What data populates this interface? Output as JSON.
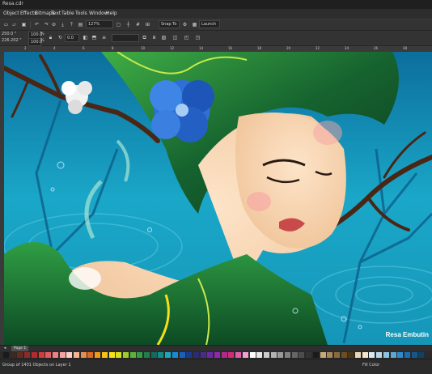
{
  "window": {
    "title": "Resa.cdr"
  },
  "menu": [
    "Object",
    "Effects",
    "Bitmaps",
    "Text",
    "Table",
    "Tools",
    "Window",
    "Help"
  ],
  "toolbar1": {
    "zoom": "127%",
    "snap_to": "Snap To",
    "launch": "Launch"
  },
  "toolbar2": {
    "x": "250.0 \"",
    "y": "226.202 \"",
    "w_percent": "100.0",
    "h_percent": "100.0",
    "pct": "%",
    "angle": "0.0"
  },
  "ruler": {
    "ticks": [
      "2",
      "4",
      "6",
      "8",
      "10",
      "12",
      "14",
      "16",
      "18",
      "20",
      "22",
      "24",
      "26",
      "28"
    ]
  },
  "canvas": {
    "signature": "Resa Embutin"
  },
  "pages": {
    "label": "Page 1"
  },
  "palette": {
    "colors": [
      "#1a1a1a",
      "#3b2a20",
      "#6b2b1b",
      "#8d2a2a",
      "#b32a2f",
      "#d83a3a",
      "#e05d5d",
      "#f08080",
      "#f6a3a3",
      "#fbd0c6",
      "#f3b48f",
      "#ea8d4e",
      "#e06a1c",
      "#f09a1a",
      "#f3c21a",
      "#f7e21a",
      "#d6e21a",
      "#9ccd2a",
      "#5cb13a",
      "#2f9e44",
      "#1f7e4a",
      "#126b5b",
      "#168a8a",
      "#1aa8b8",
      "#1a8ad2",
      "#1a5fb8",
      "#1a3b8d",
      "#2a2a7b",
      "#4a2a8d",
      "#6a2aa8",
      "#8d2aa8",
      "#b02a8d",
      "#d22a7b",
      "#e05da8",
      "#f0a3cf",
      "#ffffff",
      "#e6e6e6",
      "#cccccc",
      "#b3b3b3",
      "#999999",
      "#808080",
      "#666666",
      "#4d4d4d",
      "#333333",
      "#1a1a1a",
      "#c8a97a",
      "#a8865a",
      "#8a6a3d",
      "#6b4e26",
      "#4d3516",
      "#e8d6b8",
      "#f5e6cc",
      "#dbe8f0",
      "#b8d6ea",
      "#8ec3e0",
      "#5ba8d6",
      "#2f8ccc",
      "#1a6fb0",
      "#14578a",
      "#0f4066"
    ]
  },
  "status": {
    "text": "Group of 1401 Objects on Layer 1",
    "fill": "Fill Color"
  },
  "colors": {
    "sea": "#1aa7c8",
    "sea_dark": "#0b5e86",
    "hair": "#14532d",
    "skin": "#f7d6b5",
    "flower": "#2f6fd6"
  }
}
